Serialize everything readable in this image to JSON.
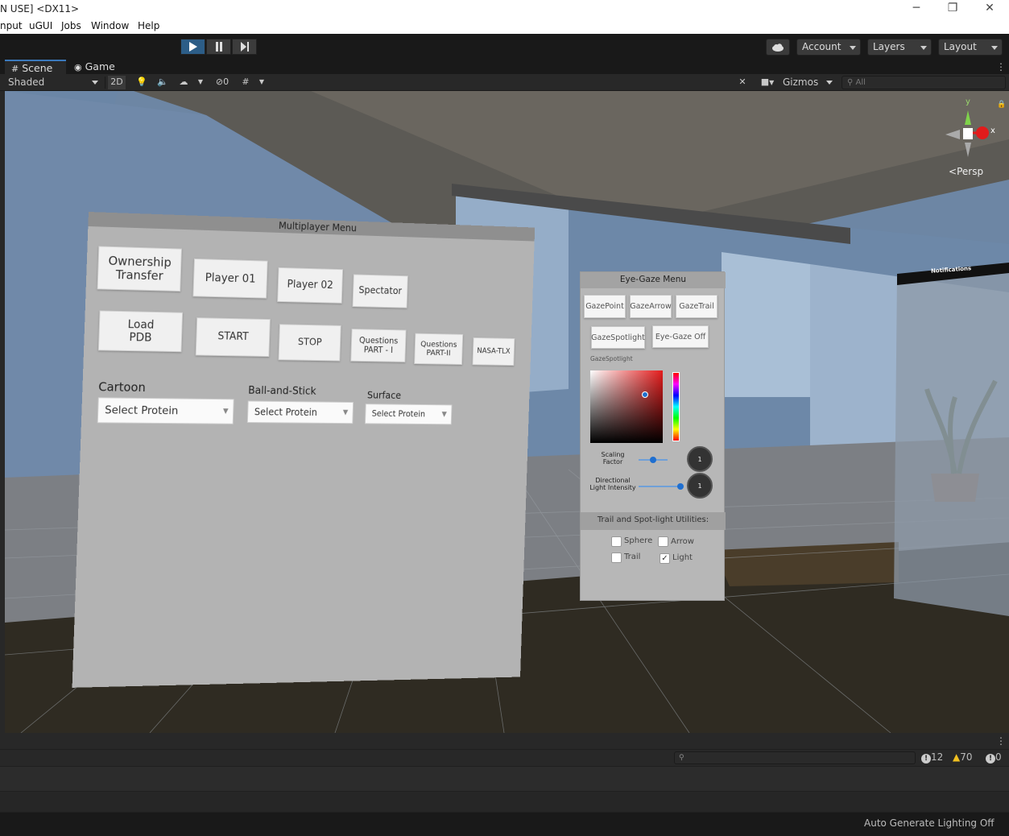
{
  "window": {
    "title": "N USE] <DX11>",
    "minimize": "─",
    "maximize": "❐",
    "close": "✕"
  },
  "menu": [
    "nput",
    "uGUI",
    "Jobs",
    "Window",
    "Help"
  ],
  "toolbar": {
    "account": "Account",
    "layers": "Layers",
    "layout": "Layout"
  },
  "tabs": {
    "scene": "Scene",
    "game": "Game"
  },
  "scene_toolbar": {
    "shading": "Shaded",
    "mode_2d": "2D",
    "hidden_count": "0",
    "gizmos": "Gizmos",
    "search_placeholder": "All"
  },
  "gizmo": {
    "y": "y",
    "x": "x",
    "persp": "Persp"
  },
  "multiplayer_menu": {
    "title": "Multiplayer Menu",
    "row1": [
      "Ownership\nTransfer",
      "Player 01",
      "Player 02",
      "Spectator"
    ],
    "row2": [
      "Load\nPDB",
      "START",
      "STOP",
      "Questions\nPART - I",
      "Questions\nPART-II",
      "NASA-TLX"
    ],
    "dropdown_labels": [
      "Cartoon",
      "Ball-and-Stick",
      "Surface"
    ],
    "dropdown_values": [
      "Select Protein",
      "Select Protein",
      "Select Protein"
    ]
  },
  "eye_gaze_menu": {
    "title": "Eye-Gaze Menu",
    "row1": [
      "GazePoint",
      "GazeArrow",
      "GazeTrail"
    ],
    "row2": [
      "GazeSpotlight",
      "Eye-Gaze Off"
    ],
    "picker_label": "GazeSpotlight",
    "scaling_label": "Scaling\nFactor",
    "scaling_value": "1",
    "light_label": "Directional\nLight Intensity",
    "light_value": "1",
    "utilities_header": "Trail and Spot-light Utilities:",
    "checkboxes": [
      {
        "label": "Sphere",
        "checked": false
      },
      {
        "label": "Arrow",
        "checked": false
      },
      {
        "label": "Trail",
        "checked": false
      },
      {
        "label": "Light",
        "checked": true
      }
    ],
    "check_mark": "✓"
  },
  "notifications": {
    "title": "Notifications"
  },
  "console": {
    "errors": "12",
    "warnings": "70",
    "info": "0"
  },
  "status": {
    "lighting": "Auto Generate Lighting Off"
  },
  "colors": {
    "accent": "#3a79bb",
    "play_active": "#2c5d87",
    "panel_bg": "#282828",
    "dark_bg": "#191919"
  }
}
